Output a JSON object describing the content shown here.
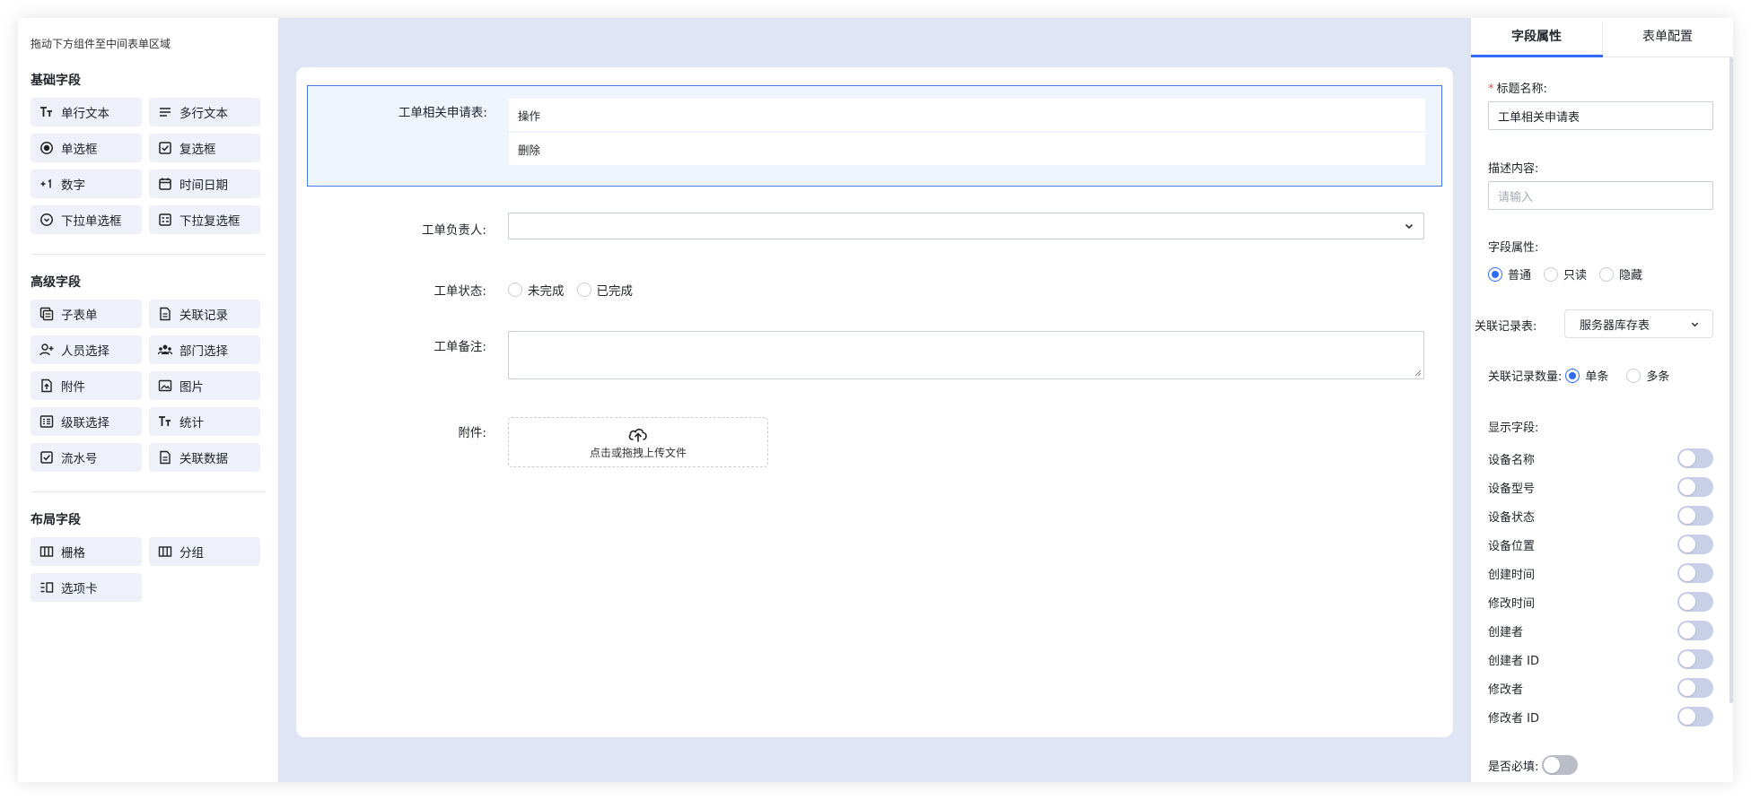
{
  "left": {
    "hint": "拖动下方组件至中间表单区域",
    "groups": [
      {
        "title": "基础字段",
        "items": [
          {
            "label": "单行文本",
            "icon": "text-icon"
          },
          {
            "label": "多行文本",
            "icon": "multiline-icon"
          },
          {
            "label": "单选框",
            "icon": "radio-icon"
          },
          {
            "label": "复选框",
            "icon": "checkbox-icon"
          },
          {
            "label": "数字",
            "icon": "number-icon"
          },
          {
            "label": "时间日期",
            "icon": "calendar-icon"
          },
          {
            "label": "下拉单选框",
            "icon": "dropdown-icon"
          },
          {
            "label": "下拉复选框",
            "icon": "dropdown-multi-icon"
          }
        ]
      },
      {
        "title": "高级字段",
        "items": [
          {
            "label": "子表单",
            "icon": "subform-icon"
          },
          {
            "label": "关联记录",
            "icon": "document-icon"
          },
          {
            "label": "人员选择",
            "icon": "user-add-icon"
          },
          {
            "label": "部门选择",
            "icon": "team-icon"
          },
          {
            "label": "附件",
            "icon": "attachment-icon"
          },
          {
            "label": "图片",
            "icon": "image-icon"
          },
          {
            "label": "级联选择",
            "icon": "cascade-icon"
          },
          {
            "label": "统计",
            "icon": "text-icon"
          },
          {
            "label": "流水号",
            "icon": "checkbox-icon"
          },
          {
            "label": "关联数据",
            "icon": "document-icon"
          }
        ]
      },
      {
        "title": "布局字段",
        "items": [
          {
            "label": "栅格",
            "icon": "grid-icon"
          },
          {
            "label": "分组",
            "icon": "grid-icon"
          },
          {
            "label": "选项卡",
            "icon": "tabs-icon"
          }
        ]
      }
    ]
  },
  "form": {
    "field1": {
      "label": "工单相关申请表:",
      "items": [
        "操作",
        "删除"
      ]
    },
    "field2": {
      "label": "工单负责人:",
      "value": ""
    },
    "field3": {
      "label": "工单状态:",
      "options": [
        "未完成",
        "已完成"
      ]
    },
    "field4": {
      "label": "工单备注:",
      "value": ""
    },
    "field5": {
      "label": "附件:",
      "upload_text": "点击或拖拽上传文件"
    }
  },
  "right": {
    "tabs": [
      "字段属性",
      "表单配置"
    ],
    "title_label": "标题名称:",
    "title_value": "工单相关申请表",
    "desc_label": "描述内容:",
    "desc_placeholder": "请输入",
    "attr_label": "字段属性:",
    "attr_options": [
      "普通",
      "只读",
      "隐藏"
    ],
    "attr_selected": "普通",
    "relation_label": "关联记录表:",
    "relation_value": "服务器库存表",
    "count_label": "关联记录数量:",
    "count_options": [
      "单条",
      "多条"
    ],
    "count_selected": "单条",
    "display_label": "显示字段:",
    "display_fields": [
      "设备名称",
      "设备型号",
      "设备状态",
      "设备位置",
      "创建时间",
      "修改时间",
      "创建者",
      "创建者 ID",
      "修改者",
      "修改者 ID"
    ],
    "required_label": "是否必填:"
  }
}
